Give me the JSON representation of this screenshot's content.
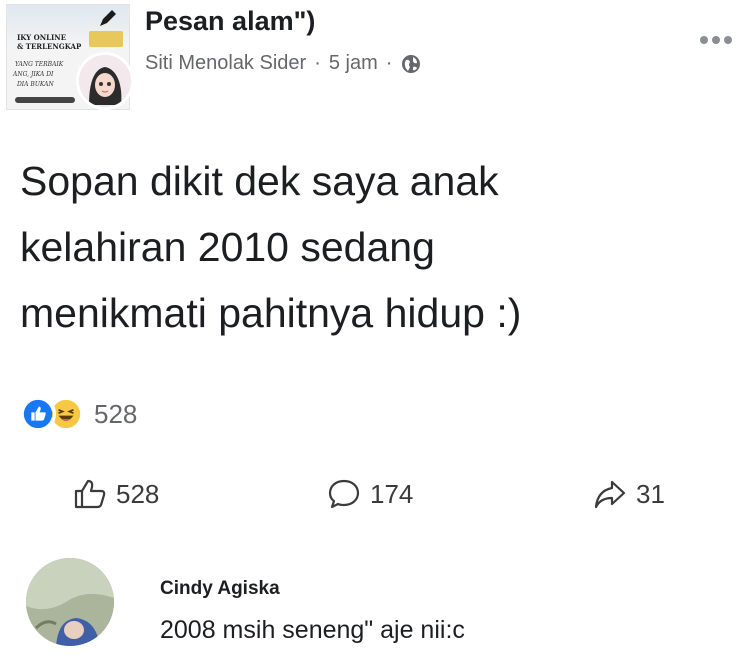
{
  "post": {
    "group_avatar_lines": [
      "IKY ONLINE",
      "& TERLENGKAP",
      "YANG TERBAIK",
      "ANG, JIKA DI",
      "DIA BUKAN"
    ],
    "title": "Pesan alam\")",
    "author": "Siti Menolak Sider",
    "separator": "·",
    "time": "5 jam",
    "body": "Sopan dikit dek saya anak\nkelahiran 2010 sedang\nmenikmati pahitnya hidup :)"
  },
  "reactions": {
    "total": "528",
    "icons": [
      "like-icon",
      "haha-icon"
    ]
  },
  "actions": {
    "like_count": "528",
    "comment_count": "174",
    "share_count": "31"
  },
  "comment": {
    "name": "Cindy Agiska",
    "text": "2008 msih seneng\" aje nii:c"
  },
  "colors": {
    "like_blue": "#1877f2",
    "haha_yellow": "#f7c844",
    "meta_gray": "#65676b",
    "text": "#1c1e21"
  }
}
